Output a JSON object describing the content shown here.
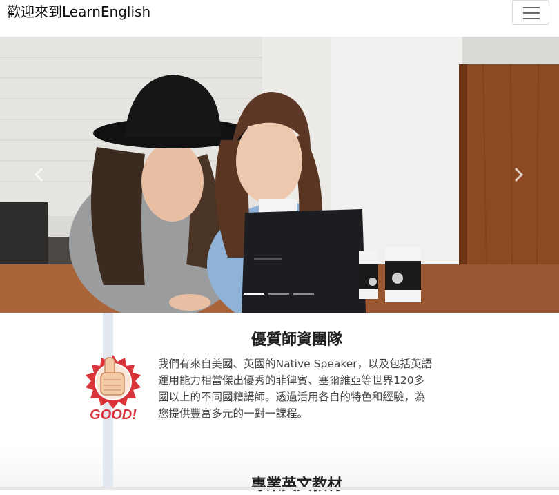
{
  "navbar": {
    "brand": "歡迎來到LearnEnglish",
    "toggler_icon": "hamburger-menu-icon"
  },
  "carousel": {
    "image_subject": "two-women-at-laptop",
    "prev_icon": "chevron-left-icon",
    "next_icon": "chevron-right-icon",
    "slide_count": 3,
    "active_slide": 1
  },
  "features": [
    {
      "title": "優質師資團隊",
      "text": "我們有來自美國、英國的Native Speaker，以及包括英語運用能力相當傑出優秀的菲律賓、塞爾維亞等世界120多國以上的不同國籍講師。透過活用各自的特色和經驗，為您提供豐富多元的一對一課程。",
      "badge_text": "GOOD!",
      "badge_icon": "thumbs-up-icon"
    },
    {
      "title": "專業英文教材"
    }
  ],
  "colors": {
    "badge_red": "#d8343a",
    "timeline_line": "#e3e8f0"
  }
}
